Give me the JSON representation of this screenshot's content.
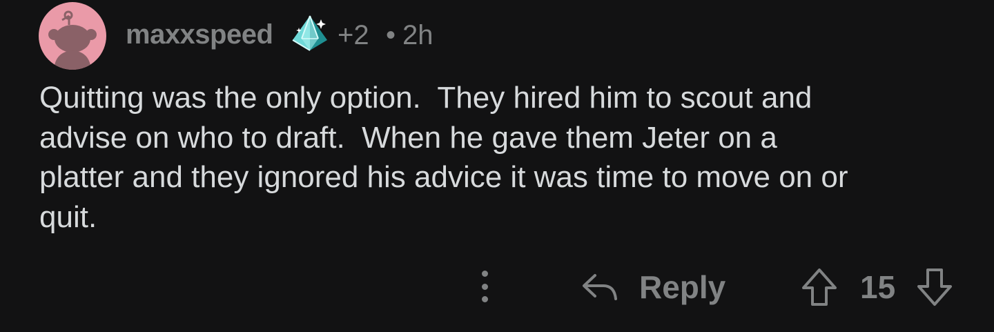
{
  "comment": {
    "author": "maxxspeed",
    "award_icon": "crystal-pyramid-award-icon",
    "award_count": "+2",
    "separator": "•",
    "timestamp": "2h",
    "body": "Quitting was the only option.  They hired him to scout and\nadvise on who to draft.  When he gave them Jeter on a\nplatter and they ignored his advice it was time to move on or\nquit."
  },
  "actions": {
    "more_icon": "vertical-ellipsis-icon",
    "reply_icon": "reply-arrow-icon",
    "reply_label": "Reply",
    "upvote_icon": "upvote-arrow-icon",
    "score": "15",
    "downvote_icon": "downvote-arrow-icon"
  },
  "colors": {
    "background": "#121213",
    "text": "#d7dadc",
    "meta": "#818384",
    "avatar_bg": "#ea9aa8",
    "award": "#7fe0de"
  }
}
